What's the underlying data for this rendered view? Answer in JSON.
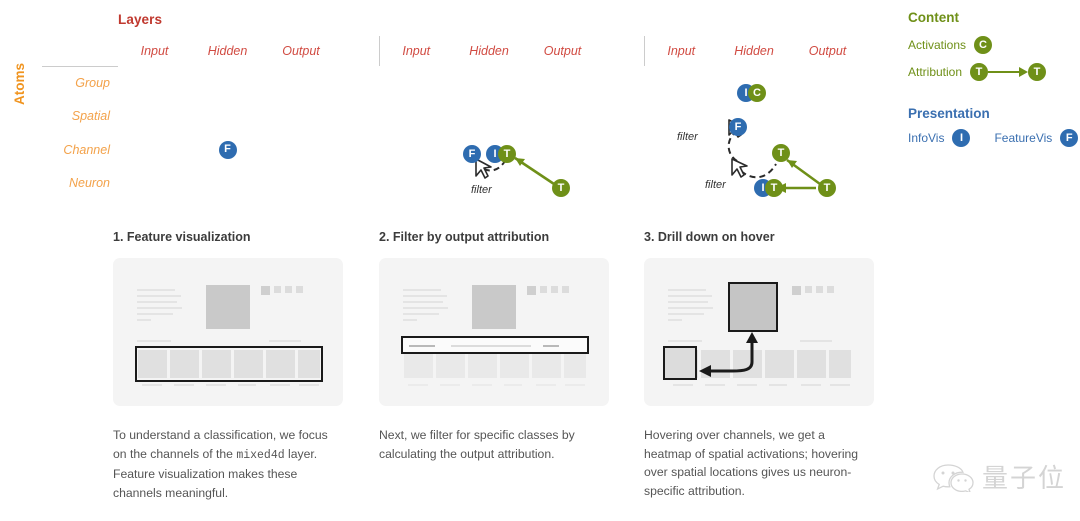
{
  "matrix_section": {
    "layers_title": "Layers",
    "atoms_title": "Atoms",
    "columns": [
      "Input",
      "Hidden",
      "Output"
    ],
    "rows": [
      "Group",
      "Spatial",
      "Channel",
      "Neuron"
    ],
    "filter_label": "filter",
    "matrices": [
      {
        "id": "matrix-1",
        "badges": [
          {
            "text": "F",
            "color": "blue"
          }
        ]
      },
      {
        "id": "matrix-2",
        "badges": [
          {
            "text": "F",
            "color": "blue"
          },
          {
            "text": "I",
            "color": "blue"
          },
          {
            "text": "T",
            "color": "green"
          },
          {
            "text": "T",
            "color": "green"
          }
        ]
      },
      {
        "id": "matrix-3",
        "badges": [
          {
            "text": "I",
            "color": "blue"
          },
          {
            "text": "C",
            "color": "green"
          },
          {
            "text": "F",
            "color": "blue"
          },
          {
            "text": "T",
            "color": "green"
          },
          {
            "text": "I",
            "color": "blue"
          },
          {
            "text": "T",
            "color": "green"
          },
          {
            "text": "T",
            "color": "green"
          }
        ]
      }
    ]
  },
  "legend": {
    "content_title": "Content",
    "presentation_title": "Presentation",
    "activations_label": "Activations",
    "activations_badge": "C",
    "attribution_label": "Attribution",
    "attribution_badge_from": "T",
    "attribution_badge_to": "T",
    "infovis_label": "InfoVis",
    "infovis_badge": "I",
    "featurevis_label": "FeatureVis",
    "featurevis_badge": "F"
  },
  "panels": [
    {
      "title": "1. Feature visualization",
      "caption_before": "To understand a classification, we focus on the channels of the ",
      "caption_mono": "mixed4d",
      "caption_after": " layer. Feature visualization makes these channels meaningful."
    },
    {
      "title": "2. Filter by output attribution",
      "caption_before": "Next, we filter for specific classes by calculating the output attribution.",
      "caption_mono": "",
      "caption_after": ""
    },
    {
      "title": "3. Drill down on hover",
      "caption_before": "Hovering over channels, we get a heatmap of spatial activations; hovering over spatial locations gives us neuron-specific attribution.",
      "caption_mono": "",
      "caption_after": ""
    }
  ],
  "watermark": {
    "text": "量子位"
  },
  "colors": {
    "red": "#c0392f",
    "orange": "#f0941f",
    "green": "#6f9018",
    "blue": "#2e6cb0",
    "legend_blue": "#3a6fb0"
  }
}
